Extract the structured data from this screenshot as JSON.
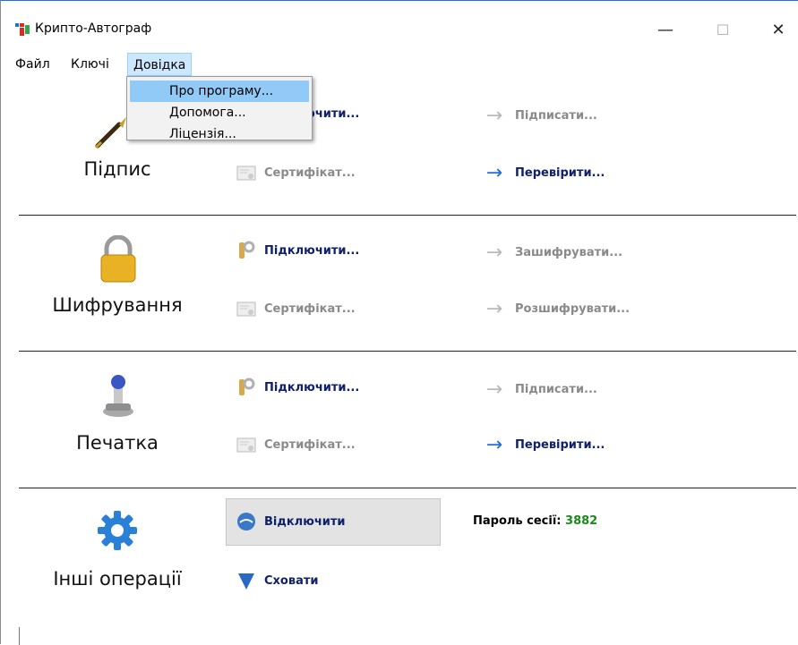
{
  "window": {
    "title": "Крипто-Автограф",
    "controls": {
      "minimize": "—",
      "maximize": "☐",
      "close": "✕"
    }
  },
  "menu": {
    "items": [
      "Файл",
      "Ключі",
      "Довідка"
    ],
    "active": "Довідка",
    "dropdown": [
      "Про програму...",
      "Допомога...",
      "Ліцензія..."
    ],
    "dropdown_highlighted": "Про програму..."
  },
  "sections": {
    "signature": {
      "title": "Підпис",
      "connect": "Підключити...",
      "certificate": "Сертифікат...",
      "action1": "Підписати...",
      "action2": "Перевірити..."
    },
    "encryption": {
      "title": "Шифрування",
      "connect": "Підключити...",
      "certificate": "Сертифікат...",
      "action1": "Зашифрувати...",
      "action2": "Розшифрувати..."
    },
    "stamp": {
      "title": "Печатка",
      "connect": "Підключити...",
      "certificate": "Сертифікат...",
      "action1": "Підписати...",
      "action2": "Перевірити..."
    },
    "other": {
      "title": "Інші операції",
      "disconnect": "Відключити",
      "hide": "Сховати",
      "session_password_label": "Пароль сесії:",
      "session_password_value": "3882"
    }
  },
  "colors": {
    "accent": "#1e6fd9",
    "enabled_text": "#10206a",
    "disabled_text": "#8a8a8a",
    "password": "#1a8a1a"
  }
}
